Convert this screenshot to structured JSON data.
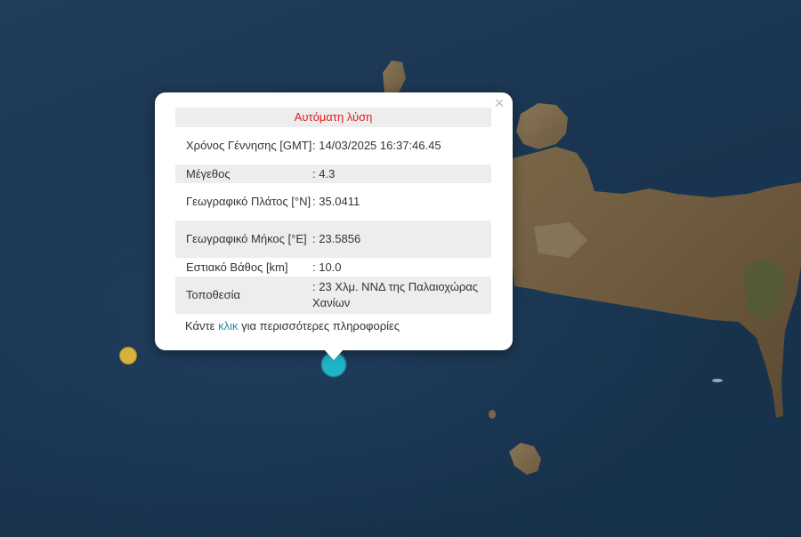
{
  "popup": {
    "title": "Αυτόματη λύση",
    "close": "×",
    "rows": [
      {
        "label": "Χρόνος Γέννησης [GMT]",
        "value": ": 14/03/2025 16:37:46.45"
      },
      {
        "label": "Μέγεθος",
        "value": ": 4.3"
      },
      {
        "label": "Γεωγραφικό Πλάτος [°N]",
        "value": ": 35.0411"
      },
      {
        "label": "Γεωγραφικό Μήκος [°E]",
        "value": ": 23.5856"
      },
      {
        "label": "Εστιακό Βάθος [km]",
        "value": ": 10.0"
      },
      {
        "label": "Τοποθεσία",
        "value": ": 23 Χλμ. ΝΝΔ της Παλαιοχώρας Χανίων"
      }
    ],
    "footer_prefix": "Κάντε ",
    "footer_link": "κλικ",
    "footer_suffix": " για περισσότερες πληροφορίες"
  },
  "colors": {
    "sea": "#1b3650",
    "marker_main": "#1fb5c9",
    "marker_other": "#d6b13b",
    "title": "#e11d1d",
    "link": "#1e8fa6"
  }
}
